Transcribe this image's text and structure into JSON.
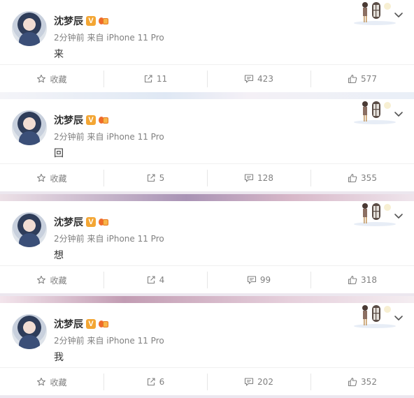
{
  "feed": [
    {
      "author": "沈梦辰",
      "verified_badge": "V",
      "meta": "2分钟前 来自 iPhone 11 Pro",
      "content": "来",
      "favorite_label": "收藏",
      "repost_count": "11",
      "comment_count": "423",
      "like_count": "577"
    },
    {
      "author": "沈梦辰",
      "verified_badge": "V",
      "meta": "2分钟前 来自 iPhone 11 Pro",
      "content": "回",
      "favorite_label": "收藏",
      "repost_count": "5",
      "comment_count": "128",
      "like_count": "355"
    },
    {
      "author": "沈梦辰",
      "verified_badge": "V",
      "meta": "2分钟前 来自 iPhone 11 Pro",
      "content": "想",
      "favorite_label": "收藏",
      "repost_count": "4",
      "comment_count": "99",
      "like_count": "318"
    },
    {
      "author": "沈梦辰",
      "verified_badge": "V",
      "meta": "2分钟前 来自 iPhone 11 Pro",
      "content": "我",
      "favorite_label": "收藏",
      "repost_count": "6",
      "comment_count": "202",
      "like_count": "352"
    }
  ],
  "colors": {
    "verified": "#f3a634",
    "text_primary": "#333333",
    "text_secondary": "#808080"
  },
  "icons": [
    "star-icon",
    "repost-icon",
    "comment-icon",
    "like-icon",
    "chevron-down-icon",
    "verified-icon",
    "vip-icon"
  ]
}
